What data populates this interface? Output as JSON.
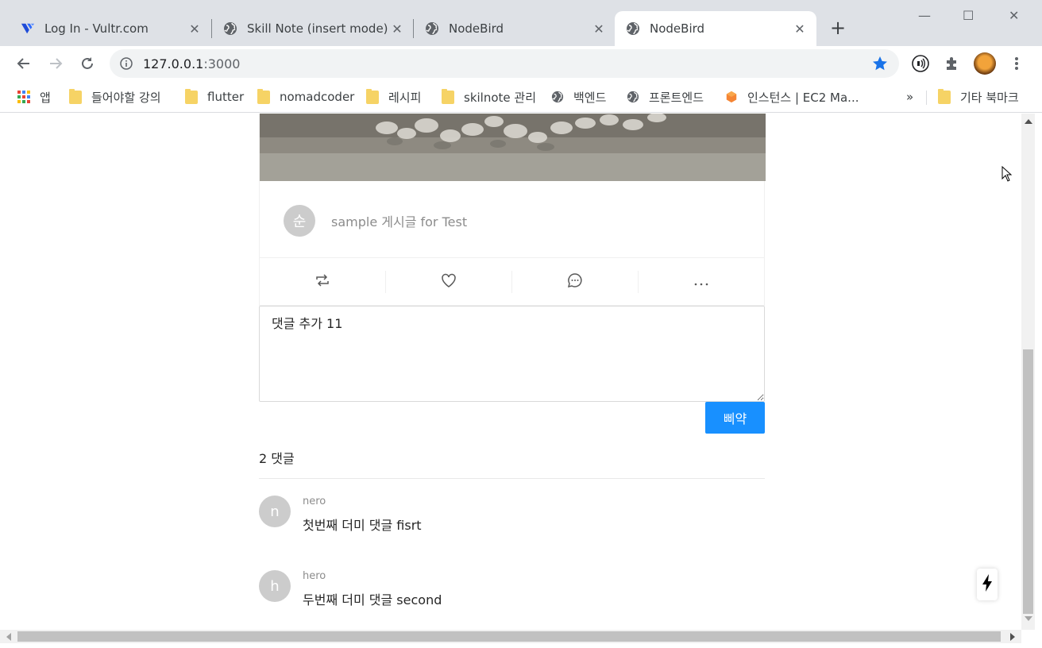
{
  "browser": {
    "tabs": [
      {
        "title": "Log In - Vultr.com",
        "favicon": "vultr-logo",
        "active": false
      },
      {
        "title": "Skill Note (insert mode)",
        "favicon": "globe-icon",
        "active": false
      },
      {
        "title": "NodeBird",
        "favicon": "globe-icon",
        "active": false
      },
      {
        "title": "NodeBird",
        "favicon": "globe-icon",
        "active": true
      }
    ],
    "new_tab_label": "+",
    "url_host": "127.0.0.1",
    "url_port": ":3000",
    "bookmarks": [
      {
        "label": "앱",
        "icon": "apps-grid-icon"
      },
      {
        "label": "들어야할 강의",
        "icon": "folder-icon"
      },
      {
        "label": "flutter",
        "icon": "folder-icon"
      },
      {
        "label": "nomadcoder",
        "icon": "folder-icon"
      },
      {
        "label": "레시피",
        "icon": "folder-icon"
      },
      {
        "label": "skilnote 관리",
        "icon": "folder-icon"
      },
      {
        "label": "백엔드",
        "icon": "globe-icon"
      },
      {
        "label": "프론트엔드",
        "icon": "globe-icon"
      },
      {
        "label": "인스턴스 | EC2 Ma...",
        "icon": "aws-icon"
      }
    ],
    "overflow_label": "»",
    "other_bookmarks": "기타 북마크"
  },
  "post": {
    "author_initial": "순",
    "content": "sample 게시글 for Test",
    "actions": [
      "retweet-icon",
      "heart-icon",
      "message-icon",
      "ellipsis-icon"
    ]
  },
  "comment_form": {
    "value": "댓글 추가 11",
    "submit_label": "삐약"
  },
  "comments": {
    "header": "2 댓글",
    "items": [
      {
        "initial": "n",
        "author": "nero",
        "content": "첫번째 더미 댓글 fisrt"
      },
      {
        "initial": "h",
        "author": "hero",
        "content": "두번째 더미 댓글 second"
      }
    ]
  },
  "colors": {
    "accent": "#1890ff",
    "avatar_bg": "#cccccc",
    "star": "#1a73e8"
  }
}
